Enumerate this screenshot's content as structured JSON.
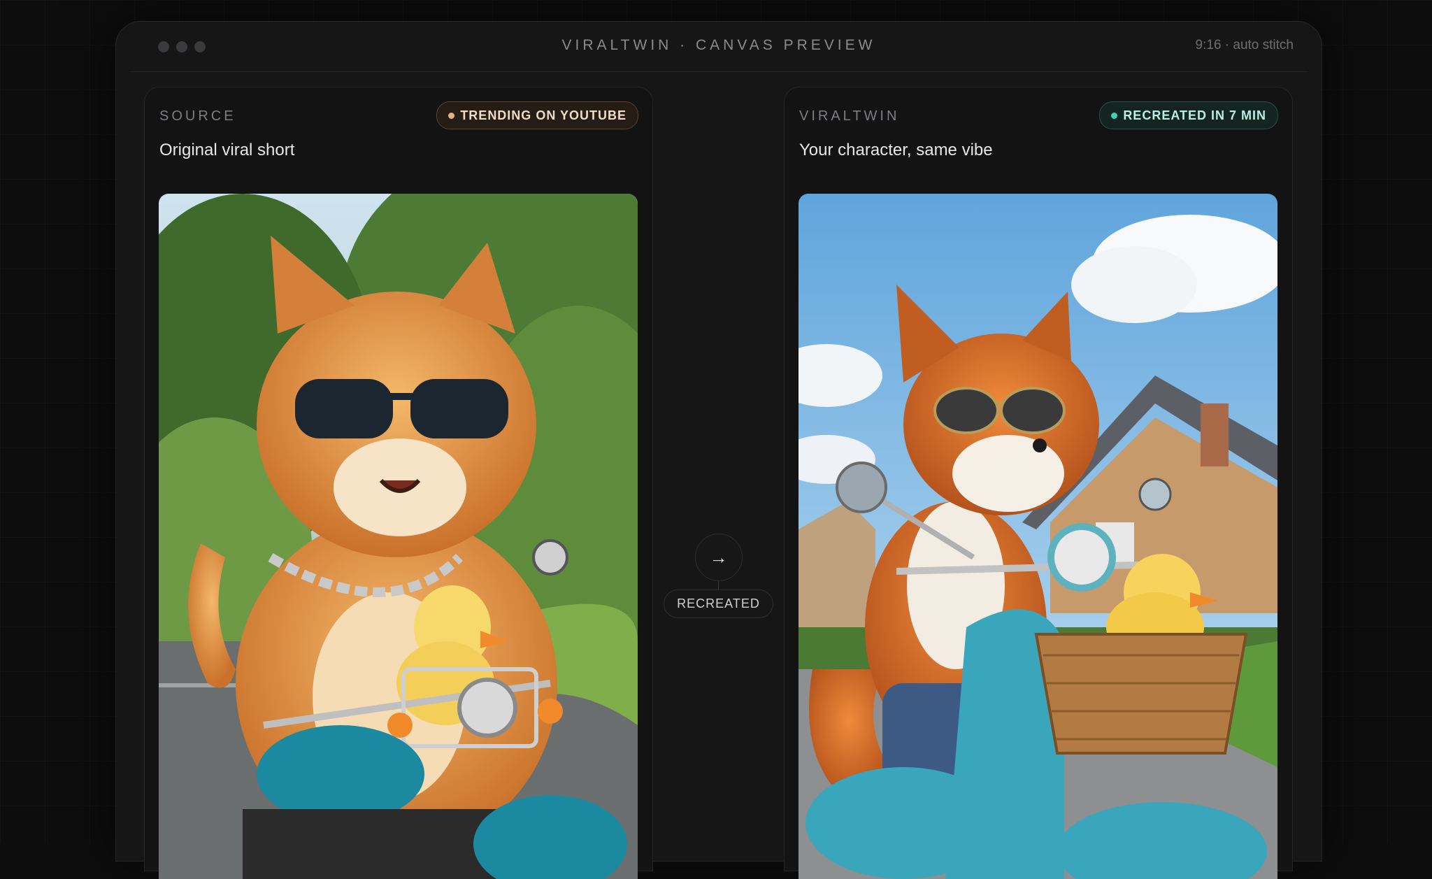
{
  "window": {
    "title": "VIRALTWIN · CANVAS PREVIEW",
    "meta": "9:16 · auto stitch"
  },
  "source": {
    "label": "SOURCE",
    "badge": "TRENDING ON YOUTUBE",
    "subtitle": "Original viral short",
    "image_alt": "Orange cat wearing sunglasses and chain riding a teal motorcycle with a duckling"
  },
  "connector": {
    "label": "RECREATED",
    "icon": "arrow-right-icon"
  },
  "viraltwin": {
    "label": "VIRALTWIN",
    "badge": "RECREATED IN 7 MIN",
    "subtitle": "Your character, same vibe",
    "image_alt": "Fox wearing aviator sunglasses riding a teal scooter with a duckling in a basket"
  },
  "colors": {
    "warm_dot": "#e8b07a",
    "cool_dot": "#3fd1b6"
  }
}
